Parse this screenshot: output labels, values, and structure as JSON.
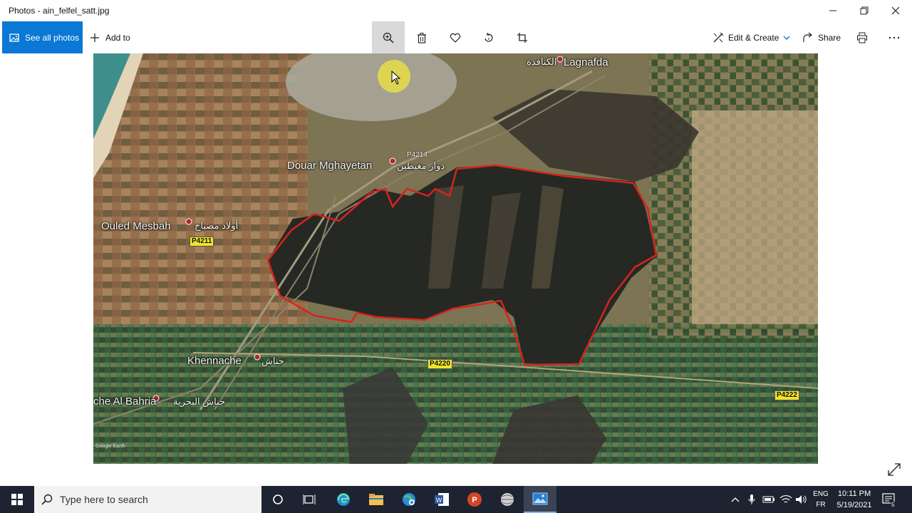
{
  "window": {
    "title": "Photos - ain_felfel_satt.jpg"
  },
  "toolbar": {
    "see_all_photos": "See all photos",
    "add_to": "Add to",
    "edit_create": "Edit & Create",
    "share": "Share"
  },
  "map": {
    "places": {
      "lagnafda": "Lagnafda",
      "lagnafda_ar": "الكنافدة",
      "douar": "Douar Mghayetan",
      "douar_ar": "دوار مغيطين",
      "ouled": "Ouled Mesbah",
      "ouled_ar": "أولاد مصباح",
      "khennache": "Khennache",
      "khennache_ar": "حناش",
      "bahria": "che Al Bahria",
      "bahria_ar": "حناش البحرية"
    },
    "roads": {
      "p4214": "P4214",
      "p4211": "P4211",
      "p4220": "P4220",
      "p4222": "P4222"
    },
    "watermark": "Google Earth"
  },
  "taskbar": {
    "search_placeholder": "Type here to search",
    "lang_line1": "ENG",
    "lang_line2": "FR",
    "time": "10:11 PM",
    "date": "5/19/2021",
    "notification_count": "5"
  },
  "colors": {
    "accent": "#0a78d4",
    "boundary": "#d8231c",
    "road_tag": "#f0e52a",
    "taskbar": "#1d2330"
  }
}
